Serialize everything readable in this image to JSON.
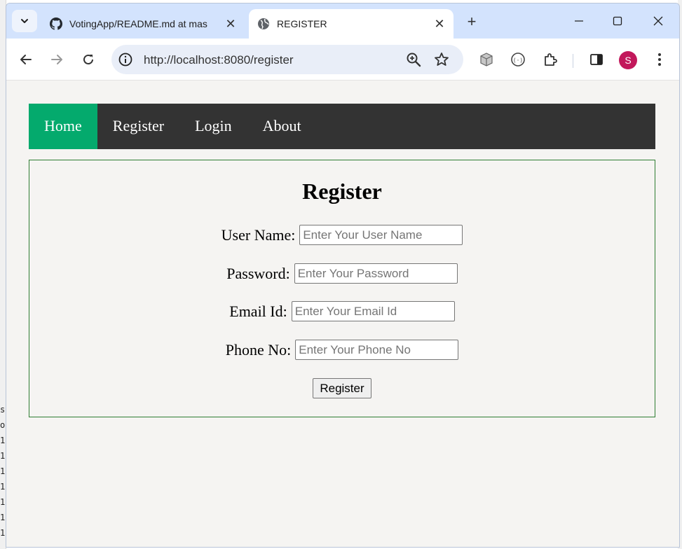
{
  "browser": {
    "tabs": [
      {
        "title": "VotingApp/README.md at mas",
        "favicon": "github-icon",
        "active": false
      },
      {
        "title": "REGISTER",
        "favicon": "globe-icon",
        "active": true
      }
    ],
    "address_url": "http://localhost:8080/register",
    "profile_initial": "S"
  },
  "nav": {
    "items": [
      {
        "label": "Home",
        "active": true
      },
      {
        "label": "Register",
        "active": false
      },
      {
        "label": "Login",
        "active": false
      },
      {
        "label": "About",
        "active": false
      }
    ]
  },
  "form": {
    "title": "Register",
    "fields": [
      {
        "label": "User Name:",
        "placeholder": "Enter Your User Name",
        "value": ""
      },
      {
        "label": "Password:",
        "placeholder": "Enter Your Password",
        "value": ""
      },
      {
        "label": "Email Id:",
        "placeholder": "Enter Your Email Id",
        "value": ""
      },
      {
        "label": "Phone No:",
        "placeholder": "Enter Your Phone No",
        "value": ""
      }
    ],
    "submit_label": "Register"
  },
  "colors": {
    "nav_background": "#333333",
    "nav_active": "#04aa6d",
    "form_border": "#2e7d32",
    "avatar": "#c2185b"
  }
}
